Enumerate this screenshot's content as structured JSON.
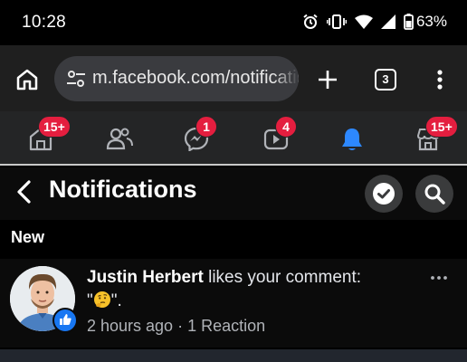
{
  "status_bar": {
    "time": "10:28",
    "battery": "63%",
    "icons": [
      "alarm-icon",
      "vibrate-icon",
      "wifi-icon",
      "signal-icon",
      "battery-icon"
    ]
  },
  "browser": {
    "url": "m.facebook.com/notifications",
    "tab_count": "3",
    "icons": [
      "home-icon",
      "site-settings-icon",
      "plus-icon",
      "tabs-icon",
      "more-vert-icon"
    ]
  },
  "fb_nav": {
    "items": [
      {
        "name": "home",
        "badge": "15+"
      },
      {
        "name": "friends",
        "badge": ""
      },
      {
        "name": "messenger",
        "badge": "1"
      },
      {
        "name": "video",
        "badge": "4"
      },
      {
        "name": "notifications",
        "badge": "",
        "active": true
      },
      {
        "name": "marketplace",
        "badge": "15+"
      }
    ],
    "active_color": "#2d88ff",
    "badge_color": "#e41e3f"
  },
  "header": {
    "title": "Notifications"
  },
  "section": {
    "label": "New"
  },
  "notifications": [
    {
      "actor": "Justin Herbert",
      "action": " likes your comment:",
      "quote_open": "\"",
      "quote_emoji": "thinking-face-icon",
      "quote_close": "\".",
      "time": "2 hours ago",
      "separator": " · ",
      "reactions": "1 Reaction",
      "reaction_type": "like"
    }
  ]
}
